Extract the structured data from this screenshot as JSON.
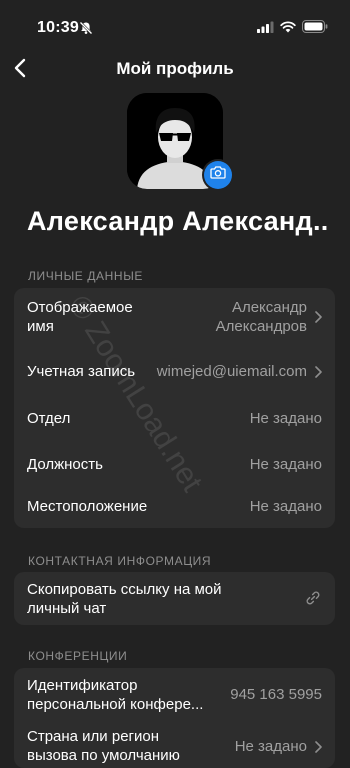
{
  "status": {
    "time": "10:39"
  },
  "nav": {
    "title": "Мой профиль"
  },
  "profile": {
    "name": "Александр Александ..."
  },
  "sections": {
    "personal": {
      "header": "ЛИЧНЫЕ ДАННЫЕ",
      "display_name_label_1": "Отображаемое",
      "display_name_label_2": "имя",
      "display_name_value_1": "Александр",
      "display_name_value_2": "Александров",
      "account_label": "Учетная запись",
      "account_value": "wimejed@uiemail.com",
      "department_label": "Отдел",
      "department_value": "Не задано",
      "position_label": "Должность",
      "position_value": "Не задано",
      "location_label": "Местоположение",
      "location_value": "Не задано"
    },
    "contact": {
      "header": "КОНТАКТНАЯ ИНФОРМАЦИЯ",
      "copy_link_label_1": "Скопировать ссылку на мой",
      "copy_link_label_2": "личный чат"
    },
    "meetings": {
      "header": "КОНФЕРЕНЦИИ",
      "pmi_label_1": "Идентификатор",
      "pmi_label_2": "персональной конфере...",
      "pmi_value": "945 163 5995",
      "country_label_1": "Страна или регион",
      "country_label_2": "вызова по умолчанию",
      "country_value": "Не задано"
    }
  },
  "watermark": "© ZoomLoad.net"
}
